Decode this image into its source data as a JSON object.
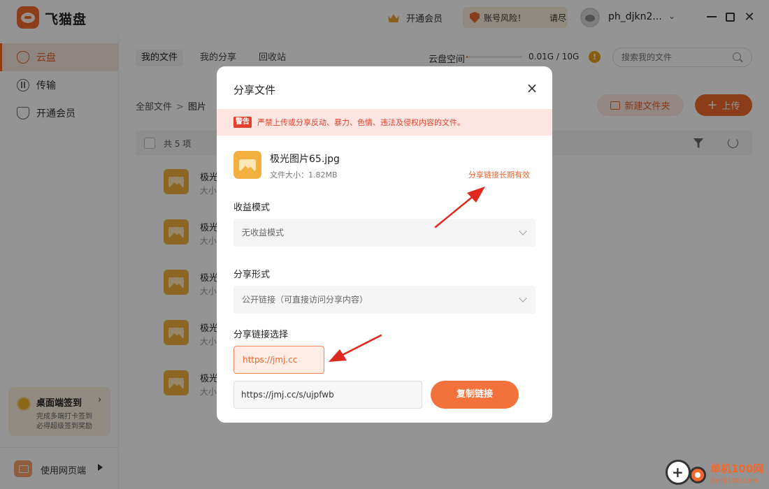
{
  "app": {
    "name": "飞猫盘"
  },
  "titlebar": {
    "vip_label": "开通会员",
    "risk_text_1": "账号风险！",
    "risk_text_2": "请尽",
    "username": "ph_djkn2...",
    "caret": "⌄"
  },
  "sidebar": {
    "items": [
      {
        "label": "云盘"
      },
      {
        "label": "传输"
      },
      {
        "label": "开通会员"
      }
    ],
    "checkin": {
      "title": "桌面端签到",
      "arrow": "›",
      "sub1": "完成多端打卡签到",
      "sub2": "必得超级签到奖励"
    },
    "web_label": "使用网页端"
  },
  "main": {
    "tabs": [
      {
        "label": "我的文件"
      },
      {
        "label": "我的分享"
      },
      {
        "label": "回收站"
      }
    ],
    "quota_label": "云盘空间",
    "quota_text": "0.01G / 10G",
    "quota_used": 0.001,
    "info_glyph": "!",
    "search_placeholder": "搜索我的文件",
    "breadcrumb": {
      "root": "全部文件",
      "sep": ">",
      "current": "图片"
    },
    "new_folder_label": "新建文件夹",
    "upload_label": "上传",
    "upload_plus": "+",
    "count_label": "共 5 项",
    "files": [
      {
        "name": "极光",
        "size": "大小"
      },
      {
        "name": "极光",
        "size": "大小"
      },
      {
        "name": "极光",
        "size": "大小"
      },
      {
        "name": "极光",
        "size": "大小"
      },
      {
        "name": "极光",
        "size": "大小"
      }
    ]
  },
  "dialog": {
    "title": "分享文件",
    "close_glyph": "×",
    "warn_tag": "警告",
    "warn_text": "严禁上传或分享反动、暴力、色情、违法及侵权内容的文件。",
    "file_name": "极光图片65.jpg",
    "file_size": "文件大小：1.82MB",
    "valid_note": "分享链接长期有效",
    "income_label": "收益模式",
    "income_value": "无收益模式",
    "form_label": "分享形式",
    "form_value": "公开链接（可直接访问分享内容）",
    "link_label": "分享链接选择",
    "link_option": "https://jmj.cc",
    "link_value": "https://jmj.cc/s/ujpfwb",
    "copy_label": "复制链接"
  },
  "watermark": {
    "text": "单机100网",
    "url": "danji100.com"
  },
  "colors": {
    "accent": "#f0692d",
    "warning": "#e2422c",
    "arrow": "#e0281e"
  }
}
